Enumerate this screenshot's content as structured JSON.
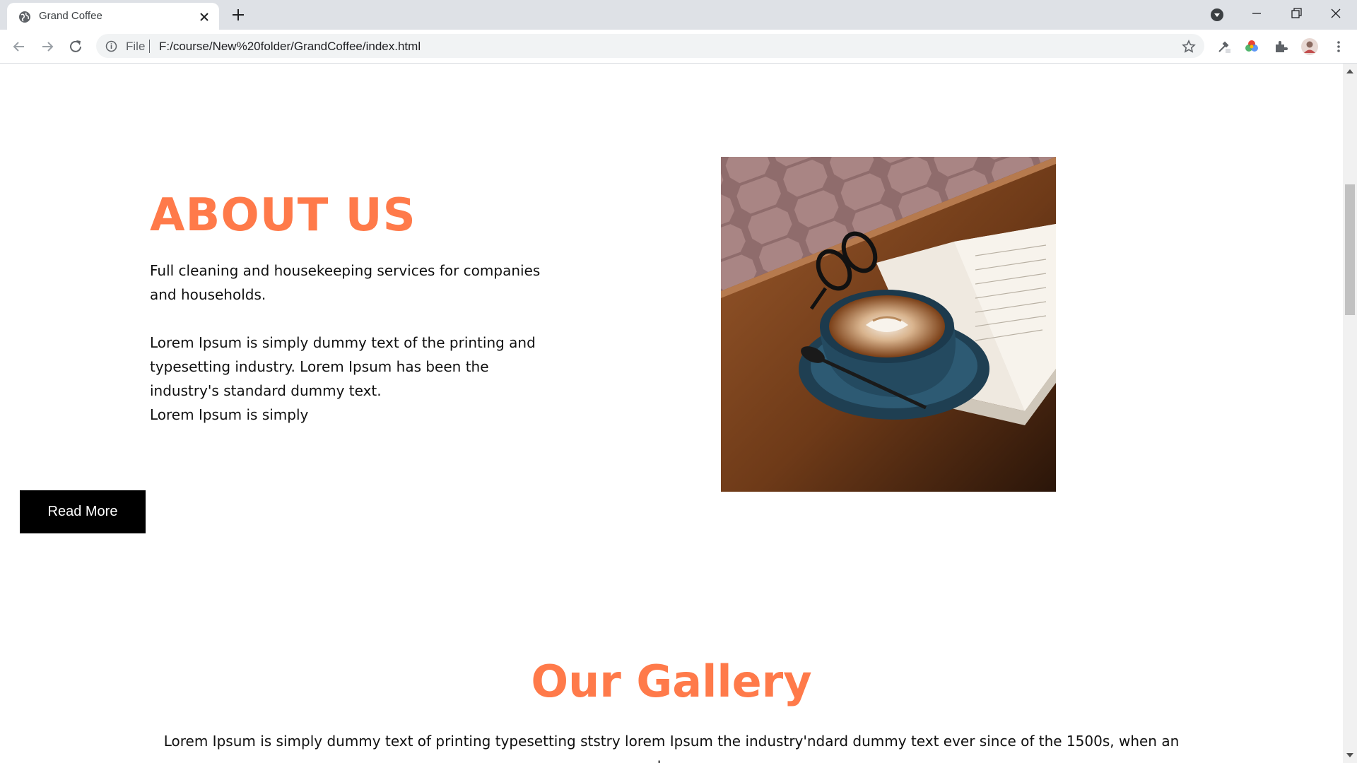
{
  "browser": {
    "tab_title": "Grand Coffee",
    "scheme_label": "File",
    "url": "F:/course/New%20folder/GrandCoffee/index.html"
  },
  "about": {
    "title": "ABOUT US",
    "lead": "Full cleaning and housekeeping services for companies and households.",
    "body_paragraph": "Lorem Ipsum is simply dummy text of the printing and typesetting industry. Lorem Ipsum has been the industry's standard dummy text.",
    "body_tail": "Lorem Ipsum is simply",
    "button_label": "Read More"
  },
  "gallery": {
    "title": "Our Gallery",
    "text": "Lorem Ipsum is simply dummy text of printing typesetting ststry lorem Ipsum the industry'ndard dummy text ever since of the 1500s, when an unknown"
  },
  "colors": {
    "accent": "#ff7a4a",
    "button_bg": "#000000",
    "button_text": "#ffffff"
  },
  "icons": [
    "globe-icon",
    "close-icon",
    "plus-icon",
    "minimize-icon",
    "restore-icon",
    "back-icon",
    "forward-icon",
    "reload-icon",
    "info-icon",
    "star-icon",
    "extensions-icon",
    "profile-icon",
    "more-icon"
  ]
}
